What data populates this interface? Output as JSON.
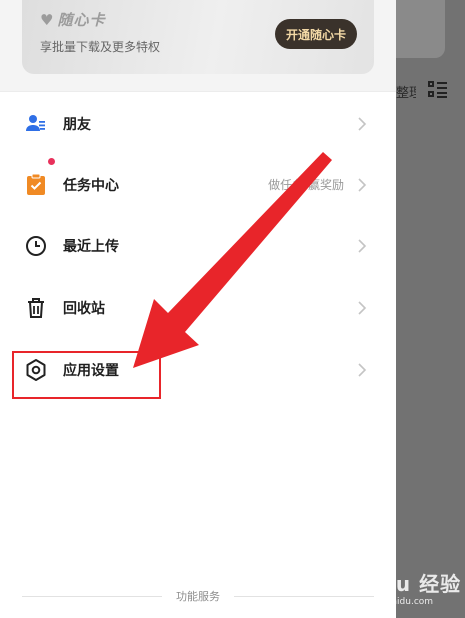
{
  "vip": {
    "title": "随心卡",
    "subtitle": "享批量下载及更多特权",
    "button": "开通随心卡"
  },
  "menu": [
    {
      "label": "朋友",
      "icon": "friends-icon",
      "hint": ""
    },
    {
      "label": "任务中心",
      "icon": "task-center-icon",
      "hint": "做任务 赢奖励",
      "badge": true
    },
    {
      "label": "最近上传",
      "icon": "clock-icon",
      "hint": ""
    },
    {
      "label": "回收站",
      "icon": "trash-icon",
      "hint": ""
    },
    {
      "label": "应用设置",
      "icon": "settings-hexagon-icon",
      "hint": ""
    }
  ],
  "footer": {
    "label": "功能服务"
  },
  "background": {
    "partial_text": "整理"
  },
  "watermark": {
    "brand": "Baidu 经验",
    "url": "jingyan.baidu.com"
  },
  "colors": {
    "annotation_red": "#e8252a",
    "badge_dot": "#e8315b",
    "task_orange": "#f08a24",
    "friends_blue": "#2f6fe6",
    "vip_button": "#3a322b"
  }
}
